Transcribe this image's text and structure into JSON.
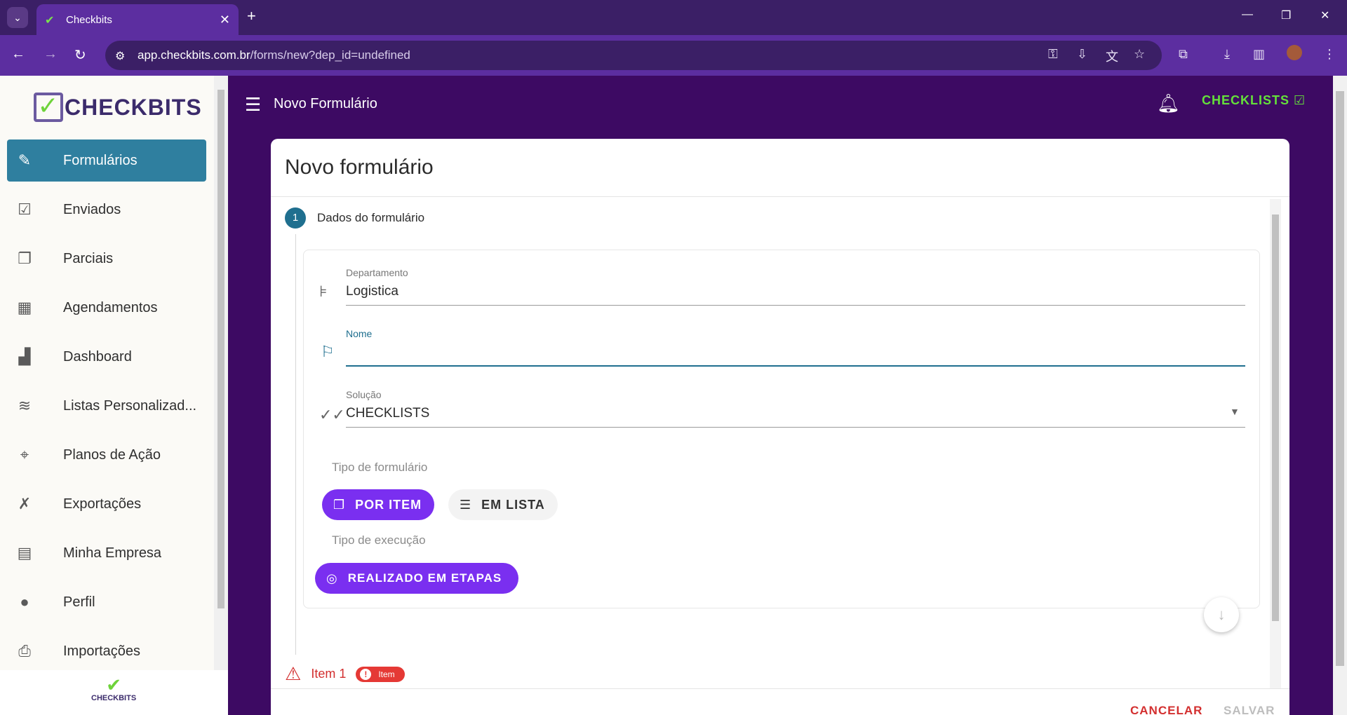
{
  "browser": {
    "tab_title": "Checkbits",
    "url_host": "app.checkbits.com.br",
    "url_path": "/forms/new?dep_id=undefined"
  },
  "sidebar": {
    "logo_text": "CHECKBITS",
    "mini_logo_text": "CHECKBITS",
    "items": [
      {
        "label": "Formulários",
        "icon": "form-edit-icon"
      },
      {
        "label": "Enviados",
        "icon": "sent-list-icon"
      },
      {
        "label": "Parciais",
        "icon": "partial-docs-icon"
      },
      {
        "label": "Agendamentos",
        "icon": "calendar-check-icon"
      },
      {
        "label": "Dashboard",
        "icon": "bar-chart-icon"
      },
      {
        "label": "Listas Personalizad...",
        "icon": "database-icon"
      },
      {
        "label": "Planos de Ação",
        "icon": "crosshair-icon"
      },
      {
        "label": "Exportações",
        "icon": "excel-file-icon"
      },
      {
        "label": "Minha Empresa",
        "icon": "building-icon"
      },
      {
        "label": "Perfil",
        "icon": "person-icon"
      },
      {
        "label": "Importações",
        "icon": "file-import-icon"
      }
    ]
  },
  "header": {
    "title": "Novo Formulário",
    "solution_badge": "CHECKLISTS"
  },
  "form": {
    "card_title": "Novo formulário",
    "step_number": "1",
    "step_label": "Dados do formulário",
    "department": {
      "label": "Departamento",
      "value": "Logistica"
    },
    "name": {
      "label": "Nome",
      "value": ""
    },
    "solution": {
      "label": "Solução",
      "value": "CHECKLISTS"
    },
    "form_type_label": "Tipo de formulário",
    "form_type_options": [
      {
        "label": "POR ITEM",
        "selected": true
      },
      {
        "label": "EM LISTA",
        "selected": false
      }
    ],
    "execution_type_label": "Tipo de execução",
    "execution_option": "REALIZADO EM ETAPAS",
    "item": {
      "label": "Item 1",
      "badge": "Item"
    },
    "cancel_label": "CANCELAR",
    "save_label": "SALVAR"
  },
  "colors": {
    "primary_purple": "#7a2ff0",
    "header_bg": "#3d0a63",
    "active_nav": "#2f7f9f",
    "accent_green": "#64e03a",
    "error_red": "#d32f2f"
  }
}
